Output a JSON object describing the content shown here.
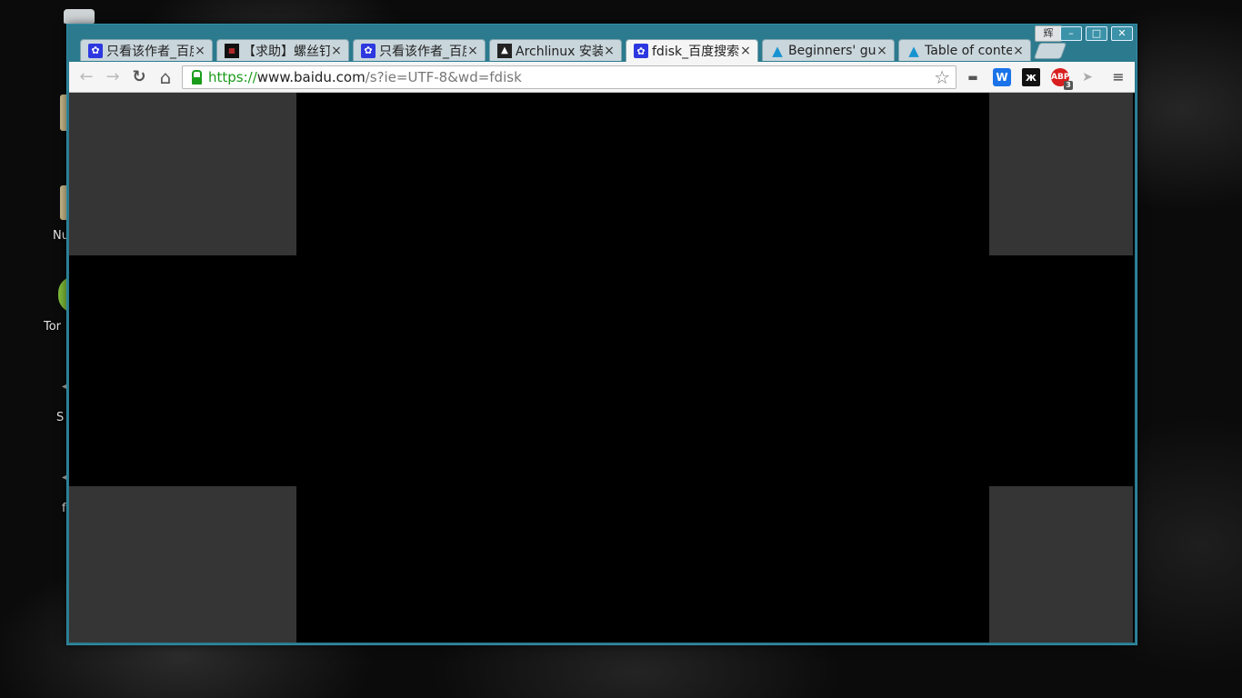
{
  "desktop": {
    "icons": [
      {
        "name": "trash",
        "label": ""
      },
      {
        "name": "folder",
        "label": ""
      },
      {
        "name": "folder-nu",
        "label": "Nu"
      },
      {
        "name": "tor",
        "label": "Tor"
      },
      {
        "name": "s-file",
        "label": "S"
      },
      {
        "name": "f-file",
        "label": "f"
      }
    ]
  },
  "window": {
    "profile_label": "辉",
    "controls": {
      "minimize": "–",
      "maximize": "□",
      "close": "✕"
    }
  },
  "tabs": [
    {
      "title": "只看该作者_百度",
      "favicon": "baidu-paw",
      "active": false
    },
    {
      "title": "【求助】螺丝钉",
      "favicon": "tieba",
      "active": false
    },
    {
      "title": "只看该作者_百度",
      "favicon": "baidu-paw",
      "active": false
    },
    {
      "title": "Archlinux 安装",
      "favicon": "archlinux-bw",
      "active": false
    },
    {
      "title": "fdisk_百度搜索",
      "favicon": "baidu-paw",
      "active": true
    },
    {
      "title": "Beginners' guide",
      "favicon": "archlinux",
      "active": false
    },
    {
      "title": "Table of contents",
      "favicon": "archlinux",
      "active": false
    }
  ],
  "toolbar": {
    "back": "←",
    "forward": "→",
    "reload": "↻",
    "home": "⌂",
    "url_scheme": "https://",
    "url_host": "www.baidu.com",
    "url_path": "/s?ie=UTF-8&wd=fdisk",
    "bookmark_star": "☆",
    "menu": "≡",
    "extensions": {
      "camera": "▬",
      "w": "W",
      "x": "ж",
      "abp": "ABP",
      "abp_badge": "3",
      "cursor": "➤"
    }
  },
  "colors": {
    "window_frame": "#2b7a8e",
    "secure_green": "#1a9c1a",
    "content_bg": "#000000",
    "block_gray": "#353535"
  }
}
